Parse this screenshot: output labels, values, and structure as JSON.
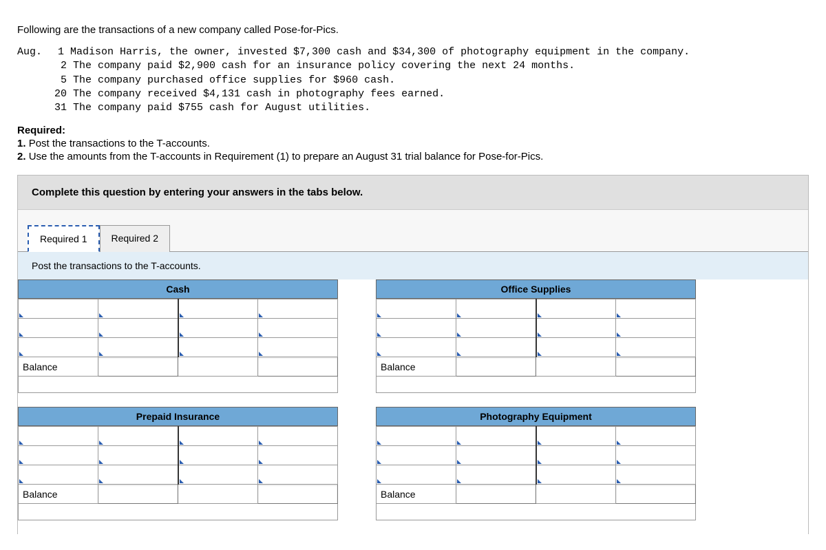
{
  "intro": "Following are the transactions of a new company called Pose-for-Pics.",
  "month_label": "Aug.",
  "transactions": [
    " 1 Madison Harris, the owner, invested $7,300 cash and $34,300 of photography equipment in the company.",
    " 2 The company paid $2,900 cash for an insurance policy covering the next 24 months.",
    " 5 The company purchased office supplies for $960 cash.",
    "20 The company received $4,131 cash in photography fees earned.",
    "31 The company paid $755 cash for August utilities."
  ],
  "required_heading": "Required:",
  "required_items": [
    "1. Post the transactions to the T-accounts.",
    "2. Use the amounts from the T-accounts in Requirement (1) to prepare an August 31 trial balance for Pose-for-Pics."
  ],
  "instr_bar": "Complete this question by entering your answers in the tabs below.",
  "tabs": [
    {
      "label": "Required 1",
      "active": true
    },
    {
      "label": "Required 2",
      "active": false
    }
  ],
  "tab_instruction": "Post the transactions to the T-accounts.",
  "balance_label": "Balance",
  "t_accounts": [
    {
      "title": "Cash"
    },
    {
      "title": "Office Supplies"
    },
    {
      "title": "Prepaid Insurance"
    },
    {
      "title": "Photography Equipment"
    }
  ]
}
